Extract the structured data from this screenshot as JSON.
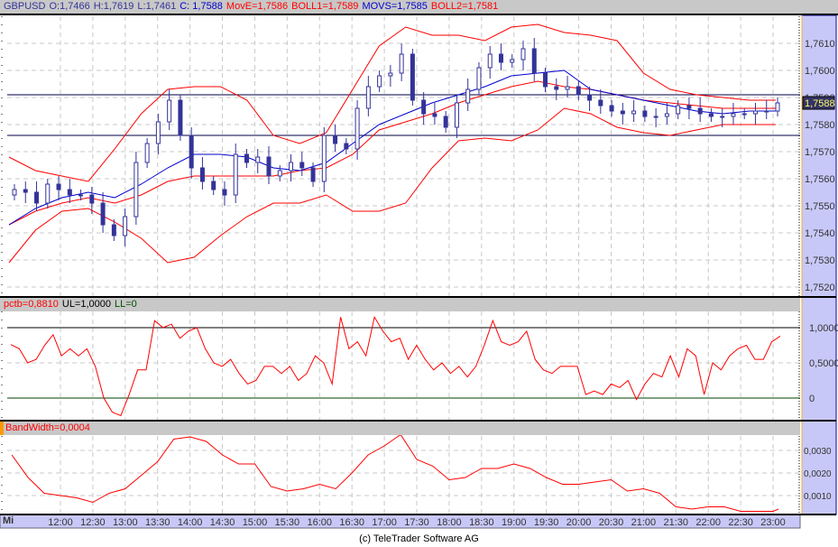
{
  "header": {
    "symbol": "GBPUSD",
    "open": "O:1,7466",
    "high": "H:1,7619",
    "low": "L:1,7461",
    "close": "C: 1,7588",
    "move": "MovE=1,7586",
    "boll1": "BOLL1=1,7589",
    "movs": "MOVS=1,7585",
    "boll2": "BOLL2=1,7581"
  },
  "pctb_header": {
    "pctb": "pctb=0,8810",
    "ul": "UL=1,0000",
    "ll": "LL=0"
  },
  "bw_header": {
    "bw": "BandWidth=0,0004"
  },
  "day_label": "Mi",
  "copyright": "(c) TeleTrader Software AG",
  "colors": {
    "upper_lower": "#ff0000",
    "move": "#ff0000",
    "movs": "#0000cc",
    "candle": "#333399",
    "axis_bg": "#c8c8f8"
  },
  "chart_data": [
    {
      "type": "candlestick",
      "title": "GBPUSD",
      "ylim": [
        1.7517,
        1.7623
      ],
      "yticks": [
        "1,7610",
        "1,7600",
        "1,7590",
        "1,7580",
        "1,7570",
        "1,7560",
        "1,7550",
        "1,7540",
        "1,7530",
        "1,7520"
      ],
      "ytick_values": [
        1.761,
        1.76,
        1.759,
        1.758,
        1.757,
        1.756,
        1.755,
        1.754,
        1.753,
        1.752
      ],
      "last_price_label": "1,7588",
      "last_price": 1.7588,
      "hlines": [
        1.7591,
        1.7576
      ],
      "closes": [
        1.7556,
        1.7555,
        1.7551,
        1.7558,
        1.7556,
        1.7554,
        1.7554,
        1.7551,
        1.7543,
        1.7539,
        1.7546,
        1.7566,
        1.7573,
        1.7581,
        1.7589,
        1.7576,
        1.7564,
        1.7559,
        1.7556,
        1.7554,
        1.7569,
        1.7566,
        1.7568,
        1.7561,
        1.7563,
        1.7566,
        1.7564,
        1.7559,
        1.7576,
        1.7573,
        1.7571,
        1.7586,
        1.7594,
        1.7598,
        1.7599,
        1.7606,
        1.7589,
        1.7584,
        1.7583,
        1.7579,
        1.7588,
        1.7593,
        1.7601,
        1.7606,
        1.7603,
        1.7604,
        1.7608,
        1.7599,
        1.7594,
        1.7593,
        1.7594,
        1.7591,
        1.7589,
        1.7587,
        1.7585,
        1.7584,
        1.7585,
        1.7583,
        1.7583,
        1.7584,
        1.7587,
        1.7586,
        1.7584,
        1.7583,
        1.7583,
        1.7584,
        1.7584,
        1.7585,
        1.7585,
        1.7588
      ],
      "series": [
        {
          "name": "BOLL1",
          "values": [
            1.7568,
            1.7563,
            1.7561,
            1.7559,
            1.7571,
            1.7584,
            1.7593,
            1.7594,
            1.7594,
            1.7589,
            1.7576,
            1.7573,
            1.7577,
            1.7593,
            1.7609,
            1.7616,
            1.7613,
            1.7613,
            1.7611,
            1.7616,
            1.7617,
            1.7614,
            1.7613,
            1.7611,
            1.7599,
            1.7593,
            1.7591,
            1.759,
            1.7589,
            1.7589
          ]
        },
        {
          "name": "BOLL2",
          "values": [
            1.7529,
            1.7541,
            1.7548,
            1.7549,
            1.7544,
            1.7538,
            1.7529,
            1.7531,
            1.7539,
            1.7546,
            1.7551,
            1.7551,
            1.7554,
            1.7548,
            1.7548,
            1.7551,
            1.7564,
            1.7574,
            1.7575,
            1.7574,
            1.7578,
            1.7586,
            1.7584,
            1.7579,
            1.7577,
            1.7576,
            1.7578,
            1.758,
            1.758,
            1.758
          ]
        },
        {
          "name": "MovE",
          "values": [
            1.7543,
            1.7548,
            1.7551,
            1.7553,
            1.7551,
            1.7554,
            1.7559,
            1.7561,
            1.7561,
            1.7561,
            1.7561,
            1.7563,
            1.7564,
            1.7569,
            1.7578,
            1.7581,
            1.7584,
            1.7588,
            1.7591,
            1.7594,
            1.7596,
            1.7594,
            1.7593,
            1.7591,
            1.7589,
            1.7588,
            1.7587,
            1.7586,
            1.7586,
            1.7586
          ]
        },
        {
          "name": "MOVS",
          "values": [
            1.7543,
            1.7549,
            1.7553,
            1.7555,
            1.7553,
            1.7558,
            1.7564,
            1.7569,
            1.7569,
            1.7568,
            1.7564,
            1.7563,
            1.7566,
            1.7573,
            1.758,
            1.7584,
            1.7588,
            1.7591,
            1.7594,
            1.7598,
            1.7599,
            1.76,
            1.7593,
            1.7591,
            1.7589,
            1.7587,
            1.7585,
            1.7584,
            1.7585,
            1.7585
          ]
        }
      ]
    },
    {
      "type": "line",
      "title": "pctb",
      "ylim": [
        -0.35,
        1.25
      ],
      "yticks": [
        "1,0000",
        "0,5000",
        "0"
      ],
      "ytick_values": [
        1,
        0.5,
        0
      ],
      "ul": 1.0,
      "ll": 0,
      "values": [
        0.76,
        0.7,
        0.5,
        0.55,
        0.75,
        0.9,
        0.6,
        0.7,
        0.6,
        0.7,
        0.45,
        0.0,
        -0.2,
        -0.25,
        0.05,
        0.4,
        0.4,
        1.1,
        1.0,
        1.05,
        0.85,
        0.95,
        1.0,
        0.7,
        0.5,
        0.45,
        0.55,
        0.35,
        0.2,
        0.25,
        0.45,
        0.45,
        0.35,
        0.45,
        0.25,
        0.35,
        0.6,
        0.5,
        0.2,
        1.15,
        0.7,
        0.8,
        0.6,
        1.15,
        0.95,
        0.8,
        0.85,
        0.55,
        0.75,
        0.55,
        0.4,
        0.5,
        0.35,
        0.45,
        0.3,
        0.45,
        0.75,
        1.1,
        0.8,
        0.75,
        0.8,
        0.95,
        0.55,
        0.4,
        0.35,
        0.45,
        0.45,
        0.45,
        0.05,
        0.1,
        0.05,
        0.2,
        0.15,
        0.25,
        -0.02,
        0.2,
        0.35,
        0.3,
        0.6,
        0.3,
        0.7,
        0.6,
        0.05,
        0.5,
        0.4,
        0.6,
        0.7,
        0.75,
        0.55,
        0.55,
        0.8,
        0.88
      ]
    },
    {
      "type": "line",
      "title": "BandWidth",
      "yticks": [
        "0,0030",
        "0,0020",
        "0,0010"
      ],
      "ytick_values": [
        0.003,
        0.002,
        0.001
      ],
      "x": [
        "11:15",
        "11:30",
        "11:45",
        "12:00",
        "12:15",
        "12:30",
        "12:45",
        "13:00",
        "13:15",
        "13:30",
        "13:45",
        "14:00",
        "14:15",
        "14:30",
        "14:45",
        "15:00",
        "15:15",
        "15:30",
        "15:45",
        "16:00",
        "16:15",
        "16:30",
        "16:45",
        "17:00",
        "17:15",
        "17:30",
        "17:45",
        "18:00",
        "18:15",
        "18:30",
        "18:45",
        "19:00",
        "19:15",
        "19:30",
        "19:45",
        "20:00",
        "20:15",
        "20:30",
        "20:45",
        "21:00",
        "21:15",
        "21:30",
        "21:45",
        "22:00",
        "22:15",
        "22:30",
        "22:45",
        "23:00",
        "23:05"
      ],
      "values": [
        0.0028,
        0.0018,
        0.0011,
        0.001,
        0.0009,
        0.0007,
        0.0011,
        0.0013,
        0.0019,
        0.0025,
        0.0035,
        0.0036,
        0.0034,
        0.0028,
        0.0024,
        0.0024,
        0.0014,
        0.0012,
        0.0013,
        0.0015,
        0.0013,
        0.002,
        0.0028,
        0.0032,
        0.0037,
        0.0026,
        0.0023,
        0.0017,
        0.0018,
        0.0022,
        0.0022,
        0.0024,
        0.0022,
        0.0018,
        0.0015,
        0.0015,
        0.0016,
        0.0017,
        0.0012,
        0.0013,
        0.0011,
        0.0005,
        0.0004,
        0.0005,
        0.0005,
        0.0003,
        0.0003,
        0.0003,
        0.0004
      ]
    },
    {
      "type": "axis",
      "xticks": [
        "12:00",
        "12:30",
        "13:00",
        "13:30",
        "14:00",
        "14:30",
        "15:00",
        "15:30",
        "16:00",
        "16:30",
        "17:00",
        "17:30",
        "18:00",
        "18:30",
        "19:00",
        "19:30",
        "20:00",
        "20:30",
        "21:00",
        "21:30",
        "22:00",
        "22:30",
        "23:00"
      ]
    }
  ]
}
